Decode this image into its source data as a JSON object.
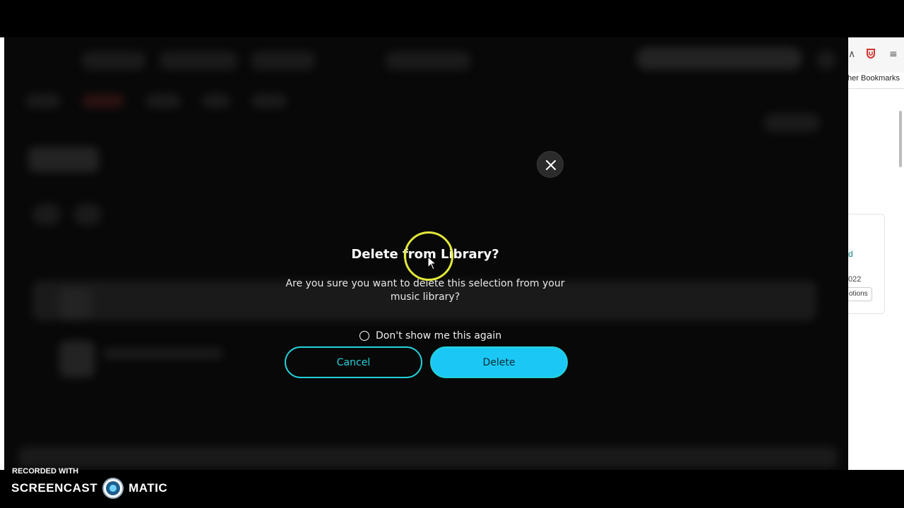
{
  "browser_sidebar": {
    "bookmarks_label": "ther Bookmarks",
    "panel_link_text": "d",
    "panel_date_text": "022",
    "panel_button_label": "otions"
  },
  "dialog": {
    "title": "Delete from Library?",
    "message": "Are you sure you want to delete this selection from your music library?",
    "dont_show_label": "Don't show me this again",
    "dont_show_checked": false,
    "cancel_label": "Cancel",
    "delete_label": "Delete",
    "accent_color": "#25d1da",
    "delete_color": "#1bc8f5"
  },
  "watermark": {
    "recorded_with": "RECORDED WITH",
    "brand_left": "SCREENCAST",
    "brand_right": "MATIC"
  }
}
